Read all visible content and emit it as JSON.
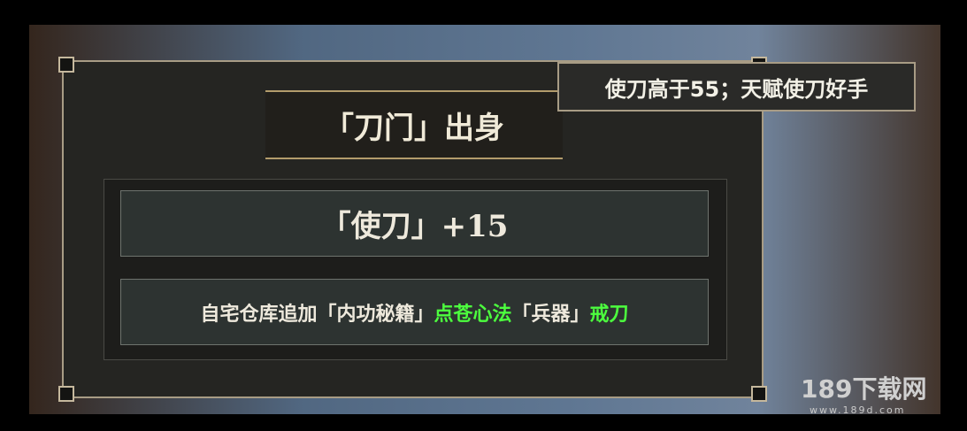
{
  "header": {
    "title": "「刀门」出身"
  },
  "stat": {
    "line": "「使刀」+15"
  },
  "effect": {
    "part1": "自宅仓库追加「内功秘籍」",
    "part2": "点苍心法",
    "part3": "「兵器」",
    "part4": "戒刀"
  },
  "tooltip": {
    "text": "使刀高于55；天赋使刀好手"
  },
  "watermark": {
    "brand": "189下载网",
    "url": "www.189d.com"
  }
}
